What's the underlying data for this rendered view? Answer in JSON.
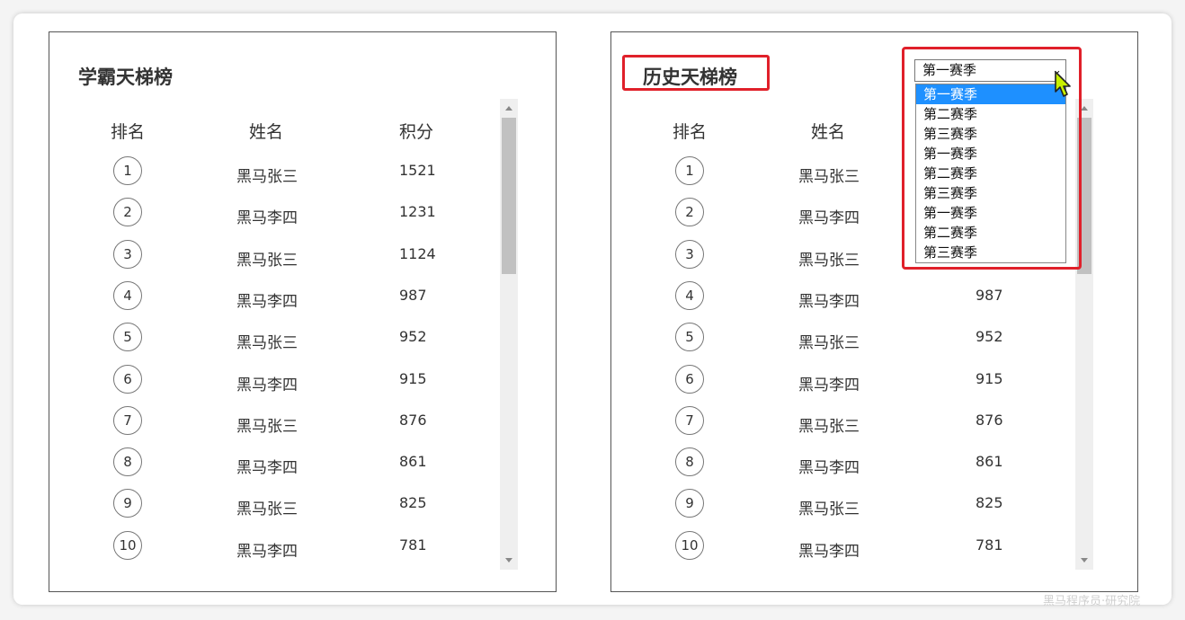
{
  "left_panel": {
    "title": "学霸天梯榜",
    "headers": {
      "rank": "排名",
      "name": "姓名",
      "score": "积分"
    },
    "rows": [
      {
        "rank": "1",
        "name": "黑马张三",
        "score": "1521"
      },
      {
        "rank": "2",
        "name": "黑马李四",
        "score": "1231"
      },
      {
        "rank": "3",
        "name": "黑马张三",
        "score": "1124"
      },
      {
        "rank": "4",
        "name": "黑马李四",
        "score": "987"
      },
      {
        "rank": "5",
        "name": "黑马张三",
        "score": "952"
      },
      {
        "rank": "6",
        "name": "黑马李四",
        "score": "915"
      },
      {
        "rank": "7",
        "name": "黑马张三",
        "score": "876"
      },
      {
        "rank": "8",
        "name": "黑马李四",
        "score": "861"
      },
      {
        "rank": "9",
        "name": "黑马张三",
        "score": "825"
      },
      {
        "rank": "10",
        "name": "黑马李四",
        "score": "781"
      }
    ]
  },
  "right_panel": {
    "title": "历史天梯榜",
    "headers": {
      "rank": "排名",
      "name": "姓名"
    },
    "rows": [
      {
        "rank": "1",
        "name": "黑马张三",
        "score": ""
      },
      {
        "rank": "2",
        "name": "黑马李四",
        "score": ""
      },
      {
        "rank": "3",
        "name": "黑马张三",
        "score": ""
      },
      {
        "rank": "4",
        "name": "黑马李四",
        "score": "987"
      },
      {
        "rank": "5",
        "name": "黑马张三",
        "score": "952"
      },
      {
        "rank": "6",
        "name": "黑马李四",
        "score": "915"
      },
      {
        "rank": "7",
        "name": "黑马张三",
        "score": "876"
      },
      {
        "rank": "8",
        "name": "黑马李四",
        "score": "861"
      },
      {
        "rank": "9",
        "name": "黑马张三",
        "score": "825"
      },
      {
        "rank": "10",
        "name": "黑马李四",
        "score": "781"
      }
    ],
    "season_select": {
      "selected": "第一赛季",
      "options": [
        "第一赛季",
        "第二赛季",
        "第三赛季",
        "第一赛季",
        "第二赛季",
        "第三赛季",
        "第一赛季",
        "第二赛季",
        "第三赛季"
      ]
    }
  },
  "highlight_color": "#e0202a",
  "selected_option_color": "#1e90ff",
  "icons": {
    "dropdown": "chevron-down-icon",
    "cursor": "pointer-cursor-icon"
  },
  "watermark": "黑马程序员·研究院"
}
